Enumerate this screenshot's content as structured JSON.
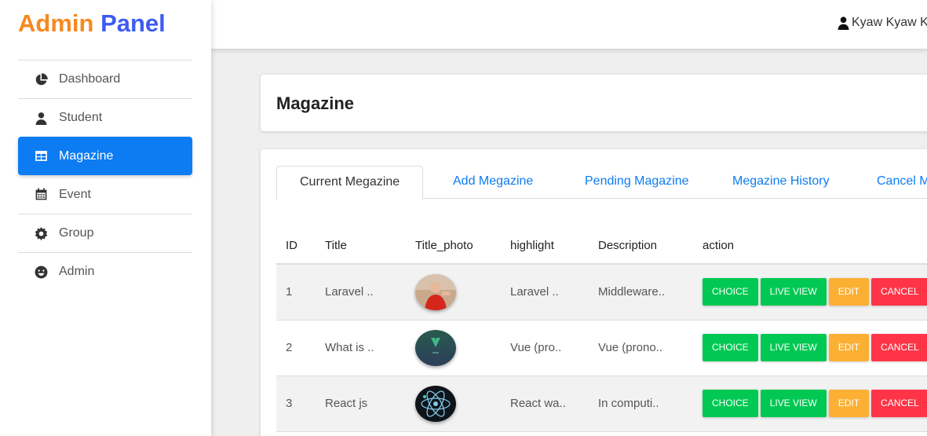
{
  "brand": {
    "part1": "Admin",
    "part2": "Panel",
    "color1": "#f5891f",
    "color2": "#3e5bf0"
  },
  "sidebar": {
    "items": [
      {
        "label": "Dashboard",
        "icon": "pie-chart-icon"
      },
      {
        "label": "Student",
        "icon": "user-icon"
      },
      {
        "label": "Magazine",
        "icon": "table-icon",
        "active": true
      },
      {
        "label": "Event",
        "icon": "calendar-icon"
      },
      {
        "label": "Group",
        "icon": "cog-icon"
      },
      {
        "label": "Admin",
        "icon": "smile-icon"
      }
    ]
  },
  "topbar": {
    "user_name": "Kyaw Kyaw K",
    "user_icon": "user-icon"
  },
  "page": {
    "title": "Magazine"
  },
  "tabs": [
    {
      "label": "Current Megazine",
      "active": true
    },
    {
      "label": "Add Megazine"
    },
    {
      "label": "Pending Magazine"
    },
    {
      "label": "Megazine History"
    },
    {
      "label": "Cancel M"
    }
  ],
  "table": {
    "headers": [
      "ID",
      "Title",
      "Title_photo",
      "highlight",
      "Description",
      "action"
    ],
    "rows": [
      {
        "id": "1",
        "title": "Laravel ..",
        "highlight": "Laravel ..",
        "description": "Middleware..",
        "photo": "presenter-photo"
      },
      {
        "id": "2",
        "title": "What is ..",
        "highlight": "Vue (pro..",
        "description": "Vue (prono..",
        "photo": "vue-logo-photo"
      },
      {
        "id": "3",
        "title": "React js",
        "highlight": "React wa..",
        "description": "In computi..",
        "photo": "react-atom-photo"
      }
    ],
    "actions": {
      "choice": "CHOICE",
      "live_view": "LIVE VIEW",
      "edit": "EDIT",
      "cancel": "CANCEL"
    }
  },
  "colors": {
    "accent": "#0d7cf2",
    "green": "#00c853",
    "orange": "#fbb034",
    "red": "#ff3547"
  }
}
